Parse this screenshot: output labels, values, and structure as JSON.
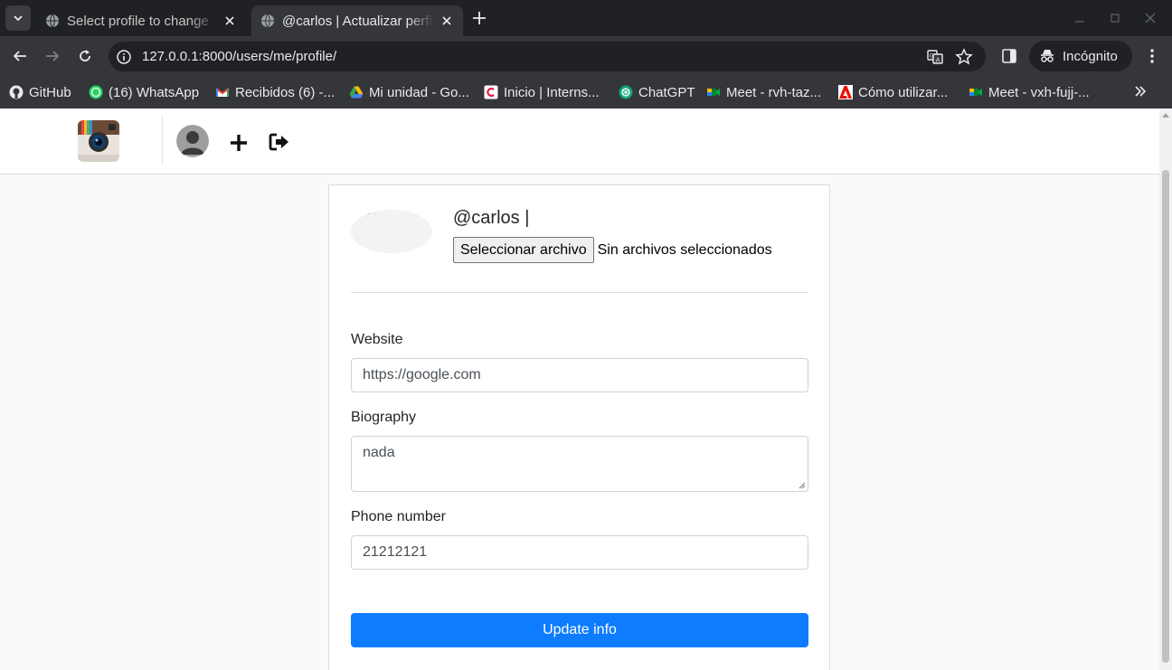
{
  "browser": {
    "tabs": [
      {
        "title": "Select profile to change",
        "active": false
      },
      {
        "title": "@carlos | Actualizar perfil",
        "active": true
      }
    ],
    "url": "127.0.0.1:8000/users/me/profile/",
    "incognito_label": "Incógnito",
    "bookmarks": [
      {
        "label": "GitHub",
        "icon": "github-icon"
      },
      {
        "label": "(16) WhatsApp",
        "icon": "whatsapp-icon"
      },
      {
        "label": "Recibidos (6) -...",
        "icon": "gmail-icon"
      },
      {
        "label": "Mi unidad - Go...",
        "icon": "drive-icon"
      },
      {
        "label": "Inicio | Interns...",
        "icon": "interns-icon"
      },
      {
        "label": "ChatGPT",
        "icon": "chatgpt-icon"
      },
      {
        "label": "Meet - rvh-taz...",
        "icon": "meet-icon"
      },
      {
        "label": "Cómo utilizar...",
        "icon": "adobe-icon"
      },
      {
        "label": "Meet - vxh-fujj-...",
        "icon": "meet-icon"
      }
    ]
  },
  "profile": {
    "username": "@carlos |",
    "file_button": "Seleccionar archivo",
    "file_status": "Sin archivos seleccionados"
  },
  "form": {
    "website_label": "Website",
    "website_value": "https://google.com",
    "biography_label": "Biography",
    "biography_value": "nada",
    "phone_label": "Phone number",
    "phone_value": "21212121",
    "submit_label": "Update info"
  },
  "colors": {
    "primary": "#0d7cff",
    "chrome_dark": "#202124",
    "chrome_toolbar": "#35363a"
  }
}
